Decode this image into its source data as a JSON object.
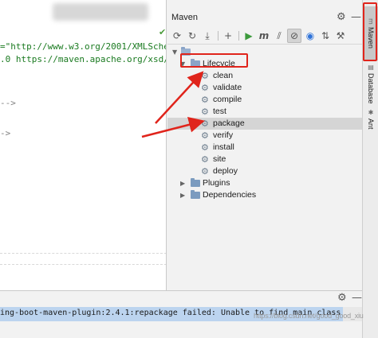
{
  "editor": {
    "line1": "=\"http://www.w3.org/2001/XMLSchema-",
    "line2": ".0 https://maven.apache.org/xsd/mav",
    "line3": "-->",
    "line4": "->"
  },
  "maven": {
    "title": "Maven",
    "header_icons": [
      "gear-icon",
      "minimize-icon"
    ],
    "toolbar": [
      "refresh-icon",
      "generate-sources-icon",
      "download-icon",
      "add-icon",
      "run-icon",
      "execute-goal-icon",
      "skip-tests-icon",
      "offline-mode-icon",
      "flash-icon",
      "collapse-icon",
      "wrench-icon"
    ],
    "tree": {
      "lifecycle_label": "Lifecycle",
      "phases": [
        "clean",
        "validate",
        "compile",
        "test",
        "package",
        "verify",
        "install",
        "site",
        "deploy"
      ],
      "highlighted_phase": "package",
      "plugins_label": "Plugins",
      "dependencies_label": "Dependencies"
    }
  },
  "side_tabs": {
    "maven": "Maven",
    "database": "Database",
    "ant": "Ant"
  },
  "bottom": {
    "error_text": "ing-boot-maven-plugin:2.4.1:repackage failed: Unable to find main class",
    "watermark": "https://blog.csdn.net/good_good_xiu"
  },
  "colors": {
    "highlight_row": "#d5d5d5",
    "annotation_red": "#e0241b",
    "error_bar": "#bcd4ef"
  }
}
